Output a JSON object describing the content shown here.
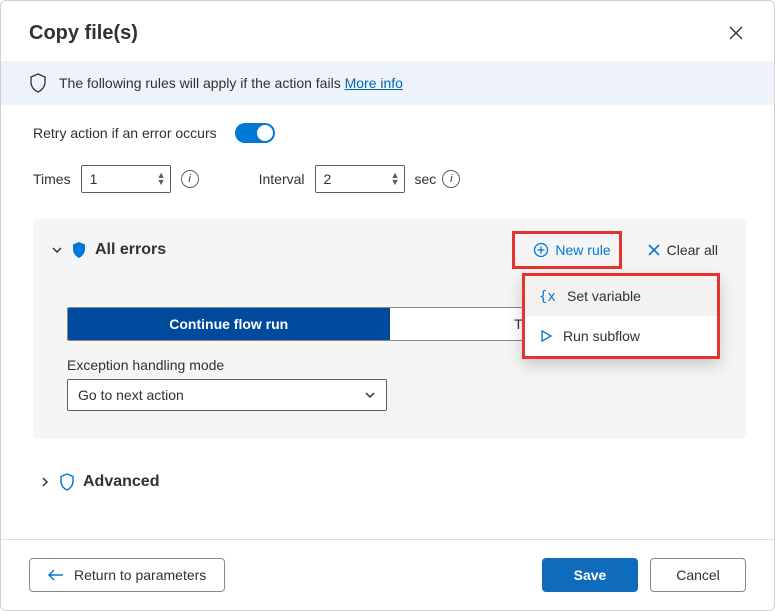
{
  "dialog": {
    "title": "Copy file(s)"
  },
  "banner": {
    "text": "The following rules will apply if the action fails",
    "link": "More info"
  },
  "retry": {
    "label": "Retry action if an error occurs",
    "enabled": true,
    "times_label": "Times",
    "times_value": "1",
    "interval_label": "Interval",
    "interval_value": "2",
    "interval_unit": "sec"
  },
  "panel": {
    "title": "All errors",
    "new_rule": "New rule",
    "clear_all": "Clear all",
    "seg_active": "Continue flow run",
    "seg_inactive": "Throw error",
    "mode_label": "Exception handling mode",
    "mode_value": "Go to next action"
  },
  "menu": {
    "item1": "Set variable",
    "item2": "Run subflow"
  },
  "advanced": {
    "label": "Advanced"
  },
  "footer": {
    "return": "Return to parameters",
    "save": "Save",
    "cancel": "Cancel"
  }
}
